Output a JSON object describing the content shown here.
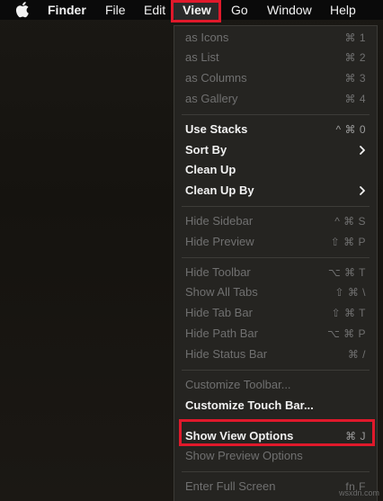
{
  "menubar": {
    "apple_icon": "apple-icon",
    "titles": {
      "finder": "Finder",
      "file": "File",
      "edit": "Edit",
      "view": "View",
      "go": "Go",
      "window": "Window",
      "help": "Help"
    },
    "highlight_color": "#e0192b"
  },
  "view_menu": {
    "items": [
      {
        "label": "as Icons",
        "shortcut": "⌘ 1",
        "enabled": false
      },
      {
        "label": "as List",
        "shortcut": "⌘ 2",
        "enabled": false
      },
      {
        "label": "as Columns",
        "shortcut": "⌘ 3",
        "enabled": false
      },
      {
        "label": "as Gallery",
        "shortcut": "⌘ 4",
        "enabled": false
      },
      {
        "label": "Use Stacks",
        "shortcut": "^ ⌘ 0",
        "enabled": true
      },
      {
        "label": "Sort By",
        "submenu": true,
        "enabled": true
      },
      {
        "label": "Clean Up",
        "enabled": true
      },
      {
        "label": "Clean Up By",
        "submenu": true,
        "enabled": true
      },
      {
        "label": "Hide Sidebar",
        "shortcut": "^ ⌘ S",
        "enabled": false
      },
      {
        "label": "Hide Preview",
        "shortcut": "⇧ ⌘ P",
        "enabled": false
      },
      {
        "label": "Hide Toolbar",
        "shortcut": "⌥ ⌘ T",
        "enabled": false
      },
      {
        "label": "Show All Tabs",
        "shortcut": "⇧ ⌘ \\",
        "enabled": false
      },
      {
        "label": "Hide Tab Bar",
        "shortcut": "⇧ ⌘ T",
        "enabled": false
      },
      {
        "label": "Hide Path Bar",
        "shortcut": "⌥ ⌘ P",
        "enabled": false
      },
      {
        "label": "Hide Status Bar",
        "shortcut": "⌘ /",
        "enabled": false
      },
      {
        "label": "Customize Toolbar...",
        "enabled": false
      },
      {
        "label": "Customize Touch Bar...",
        "enabled": true
      },
      {
        "label": "Show View Options",
        "shortcut": "⌘ J",
        "enabled": true,
        "highlighted": true
      },
      {
        "label": "Show Preview Options",
        "enabled": false
      },
      {
        "label": "Enter Full Screen",
        "shortcut": "fn F",
        "enabled": false
      }
    ],
    "icons": {
      "submenu": "chevron-right-icon"
    }
  },
  "watermark": "wsxdn.com"
}
